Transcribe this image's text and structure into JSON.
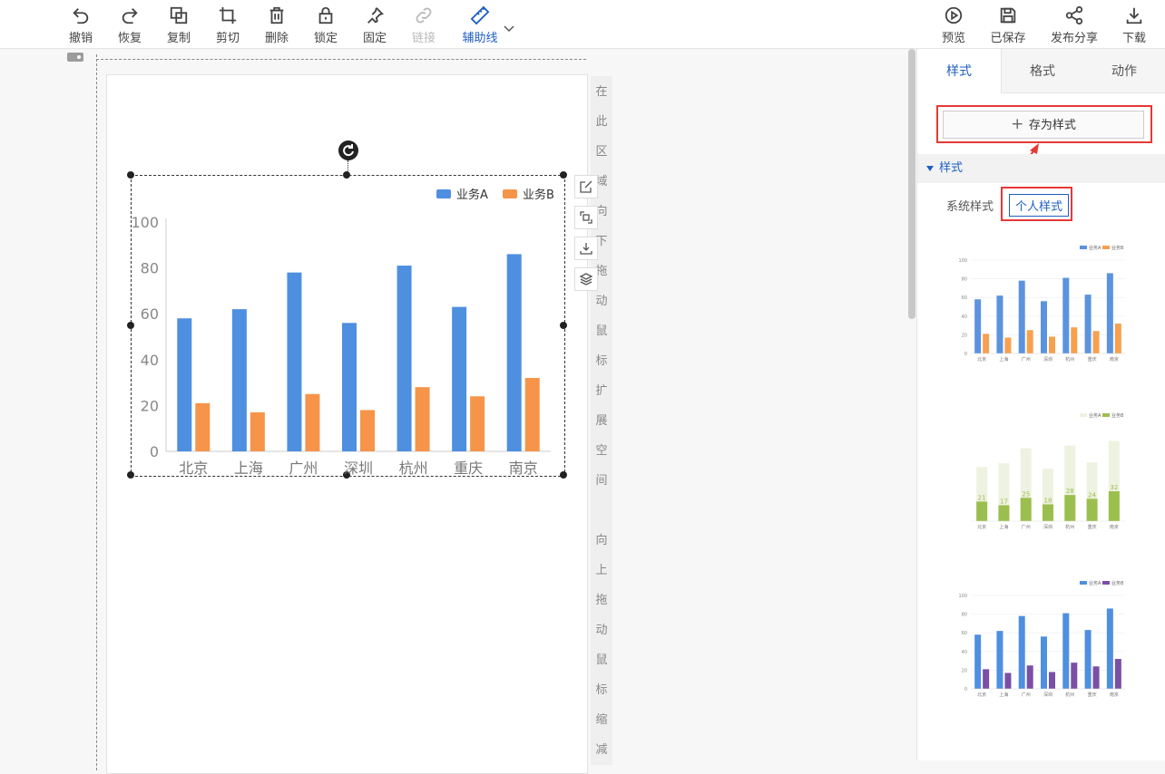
{
  "toolbar": {
    "left": [
      {
        "label": "撤销",
        "icon": "undo-icon"
      },
      {
        "label": "恢复",
        "icon": "redo-icon"
      },
      {
        "label": "复制",
        "icon": "copy-icon"
      },
      {
        "label": "剪切",
        "icon": "crop-icon"
      },
      {
        "label": "删除",
        "icon": "trash-icon"
      },
      {
        "label": "锁定",
        "icon": "lock-icon"
      },
      {
        "label": "固定",
        "icon": "pin-icon"
      },
      {
        "label": "链接",
        "icon": "link-icon",
        "disabled": true
      },
      {
        "label": "辅助线",
        "icon": "ruler-icon",
        "active": true
      }
    ],
    "right": [
      {
        "label": "预览",
        "icon": "play-icon"
      },
      {
        "label": "已保存",
        "icon": "save-icon"
      },
      {
        "label": "发布分享",
        "icon": "share-icon"
      },
      {
        "label": "下载",
        "icon": "download-icon"
      }
    ]
  },
  "canvas": {
    "hint_expand": [
      "在",
      "此",
      "区",
      "域",
      "向",
      "下",
      "拖",
      "动",
      "鼠",
      "标",
      "扩",
      "展",
      "空",
      "间"
    ],
    "hint_shrink": [
      "向",
      "上",
      "拖",
      "动",
      "鼠",
      "标",
      "缩",
      "减"
    ]
  },
  "chart_data": {
    "type": "bar",
    "categories": [
      "北京",
      "上海",
      "广州",
      "深圳",
      "杭州",
      "重庆",
      "南京"
    ],
    "series": [
      {
        "name": "业务A",
        "values": [
          58,
          62,
          78,
          56,
          81,
          63,
          86
        ],
        "color": "#4e8fe0"
      },
      {
        "name": "业务B",
        "values": [
          21,
          17,
          25,
          18,
          28,
          24,
          32
        ],
        "color": "#f6944a"
      }
    ],
    "ylim": [
      0,
      100
    ],
    "yticks": [
      0,
      20,
      40,
      60,
      80,
      100
    ],
    "legend": "top-right",
    "grid": false
  },
  "panel": {
    "tabs": [
      "样式",
      "格式",
      "动作"
    ],
    "active_tab": "样式",
    "save_style_label": "存为样式",
    "section_title": "样式",
    "system_styles": "系统样式",
    "personal_styles": "个人样式",
    "thumbnails": [
      {
        "legend": [
          "业务A",
          "业务B"
        ],
        "a": [
          58,
          62,
          78,
          56,
          81,
          63,
          86
        ],
        "b": [
          21,
          17,
          25,
          18,
          28,
          24,
          32
        ],
        "colorA": "#5b93de",
        "colorB": "#f7a050",
        "yticks": [
          "0",
          "20",
          "40",
          "60",
          "80",
          "100"
        ]
      },
      {
        "legend": [
          "业务A",
          "业务B"
        ],
        "a": [
          58,
          62,
          78,
          56,
          81,
          63,
          86
        ],
        "b": [
          21,
          17,
          25,
          18,
          28,
          24,
          32
        ],
        "labels": [
          "21",
          "17",
          "25",
          "18",
          "28",
          "24",
          "32"
        ],
        "colorA": "#eef2e0",
        "colorB": "#9bbf4e"
      },
      {
        "legend": [
          "业务A",
          "业务B"
        ],
        "a": [
          58,
          62,
          78,
          56,
          81,
          63,
          86
        ],
        "b": [
          21,
          17,
          25,
          18,
          28,
          24,
          32
        ],
        "colorA": "#4e8fe0",
        "colorB": "#7a4fa6",
        "yticks": [
          "0",
          "20",
          "40",
          "60",
          "80",
          "100"
        ]
      }
    ],
    "thumb_categories": [
      "北京",
      "上海",
      "广州",
      "深圳",
      "杭州",
      "重庆",
      "南京"
    ]
  }
}
